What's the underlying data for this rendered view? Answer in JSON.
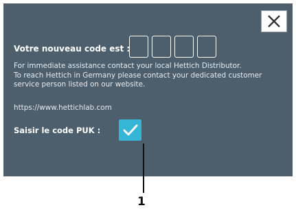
{
  "dialog": {
    "code_label": "Votre nouveau code est :",
    "code_boxes": [
      "",
      "",
      "",
      ""
    ],
    "info_lines": [
      "For immediate assistance contact your local Hettich Distributor.",
      "To reach Hettich in Germany please contact your dedicated customer",
      "service person listed on our website."
    ],
    "url": "https://www.hettichlab.com",
    "puk_label": "Saisir le code PUK :",
    "close_icon": "close-icon",
    "confirm_icon": "checkmark-icon"
  },
  "callout": {
    "number": "1"
  },
  "colors": {
    "dialog_background": "#4d5f6d",
    "confirm_accent": "#36b6d6",
    "text": "#ffffff"
  }
}
